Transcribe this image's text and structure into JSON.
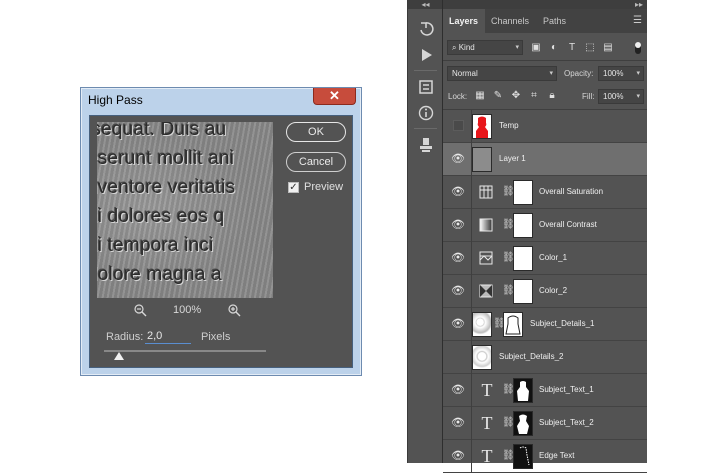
{
  "dialog": {
    "title": "High Pass",
    "close_glyph": "✕",
    "ok_label": "OK",
    "cancel_label": "Cancel",
    "preview_label": "Preview",
    "preview_checked": true,
    "zoom_pct": "100%",
    "zoom_out_icon": "zoom-out-icon",
    "zoom_in_icon": "zoom-in-icon",
    "radius_label": "Radius:",
    "radius_value": "2,0",
    "radius_unit": "Pixels",
    "preview_text": [
      "isequat. Duis au",
      "eserunt mollit ani",
      "nventore veritatis",
      "ni dolores eos q",
      "ni tempora inci",
      "dolore magna a"
    ]
  },
  "toolstrip": {
    "collapse_glyph": "◂◂",
    "icons": [
      "history-brush-icon",
      "play-icon",
      "properties-icon",
      "info-icon",
      "clone-source-icon"
    ]
  },
  "panel": {
    "collapse_glyph": "▸▸",
    "tabs": [
      {
        "label": "Layers",
        "active": true
      },
      {
        "label": "Channels",
        "active": false
      },
      {
        "label": "Paths",
        "active": false
      }
    ],
    "filter": {
      "value": "Kind"
    },
    "blend_mode": "Normal",
    "opacity_label": "Opacity:",
    "opacity_value": "100%",
    "lock_label": "Lock:",
    "fill_label": "Fill:",
    "fill_value": "100%",
    "layers": [
      {
        "name": "Temp",
        "visible": false,
        "kind": "raster-red"
      },
      {
        "name": "Layer 1",
        "visible": true,
        "kind": "raster-gray",
        "selected": true
      },
      {
        "name": "Overall Saturation",
        "visible": true,
        "kind": "adjust-hue"
      },
      {
        "name": "Overall Contrast",
        "visible": true,
        "kind": "adjust-levels"
      },
      {
        "name": "Color_1",
        "visible": true,
        "kind": "adjust-lookup"
      },
      {
        "name": "Color_2",
        "visible": true,
        "kind": "adjust-gradient"
      },
      {
        "name": "Subject_Details_1",
        "visible": true,
        "kind": "masked-texture"
      },
      {
        "name": "Subject_Details_2",
        "visible": false,
        "kind": "texture"
      },
      {
        "name": "Subject_Text_1",
        "visible": true,
        "kind": "type"
      },
      {
        "name": "Subject_Text_2",
        "visible": true,
        "kind": "type"
      },
      {
        "name": "Edge Text",
        "visible": true,
        "kind": "type"
      }
    ]
  }
}
